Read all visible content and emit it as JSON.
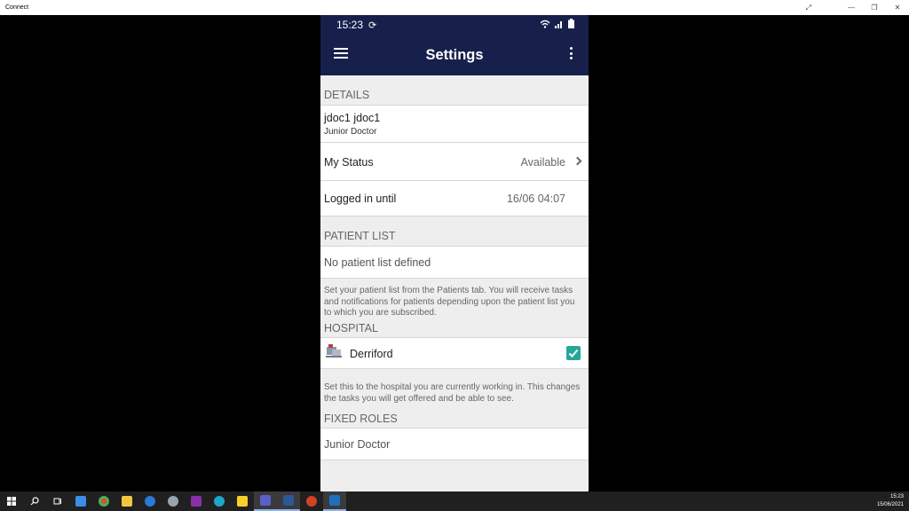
{
  "window": {
    "title": "Connect"
  },
  "phone_status": {
    "time": "15:23"
  },
  "appbar": {
    "title": "Settings"
  },
  "details": {
    "header": "DETAILS",
    "user_name": "jdoc1 jdoc1",
    "user_role": "Junior Doctor",
    "status_label": "My Status",
    "status_value": "Available",
    "logged_label": "Logged in until",
    "logged_value": "16/06 04:07"
  },
  "patient_list": {
    "header": "PATIENT LIST",
    "value": "No patient list defined",
    "help": "Set your patient list from the Patients tab. You will receive tasks and notifications for patients depending upon the patient list you to which you are subscribed."
  },
  "hospital": {
    "header": "HOSPITAL",
    "name": "Derriford",
    "checked": true,
    "help": "Set this to the hospital you are currently working in. This changes the tasks you will get offered and be able to see."
  },
  "fixed_roles": {
    "header": "FIXED ROLES",
    "value": "Junior Doctor"
  },
  "taskbar": {
    "clock_time": "15:23",
    "clock_date": "15/06/2021"
  },
  "colors": {
    "appbar": "#17204b",
    "checkbox": "#26a69a"
  }
}
